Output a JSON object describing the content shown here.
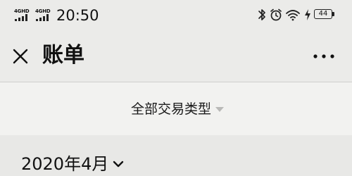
{
  "status_bar": {
    "signal_1": "4GHD",
    "signal_2": "4GHD",
    "time": "20:50",
    "icons": [
      "bluetooth-icon",
      "alarm-icon",
      "wifi-icon",
      "charging-icon"
    ],
    "battery": "44"
  },
  "nav": {
    "title": "账单",
    "close_icon": "close-icon",
    "more_icon": "more-icon"
  },
  "filter": {
    "label": "全部交易类型"
  },
  "month": {
    "label": "2020年4月"
  }
}
